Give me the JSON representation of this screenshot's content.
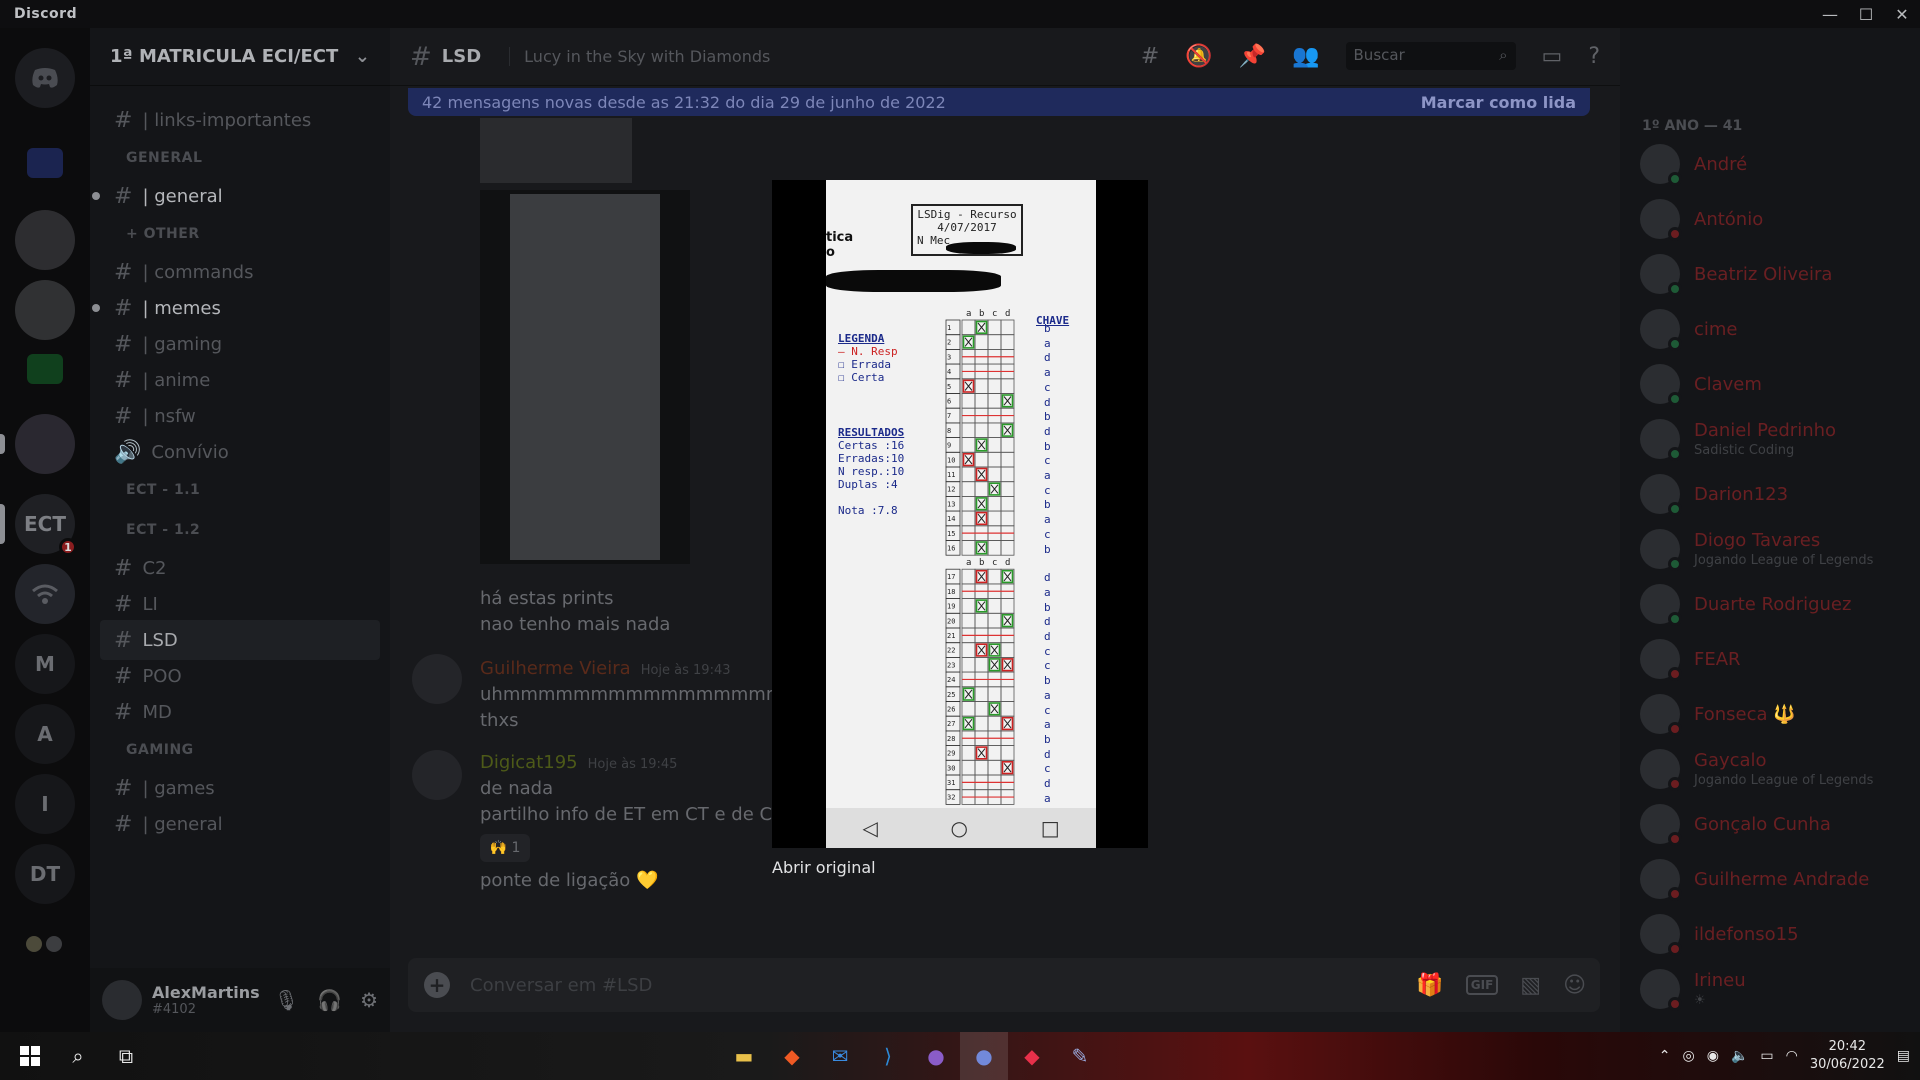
{
  "app": {
    "brand": "Discord"
  },
  "window_controls": {
    "minimize": "—",
    "maximize": "☐",
    "close": "✕"
  },
  "guilds": [
    {
      "label": "",
      "icon": "discord-home-icon"
    },
    {
      "label": "",
      "icon": "folder-icon"
    },
    {
      "label": "",
      "icon": "server-avatar"
    },
    {
      "label": "",
      "icon": "server-avatar"
    },
    {
      "label": "",
      "icon": "folder-icon"
    },
    {
      "label": "",
      "icon": "server-avatar"
    },
    {
      "label": "ECT",
      "badge": "1"
    },
    {
      "label": "",
      "icon": "wifi-server-icon"
    },
    {
      "label": "M"
    },
    {
      "label": "A"
    },
    {
      "label": "I"
    },
    {
      "label": "DT"
    }
  ],
  "server": {
    "name": "1ª MATRICULA ECI/ECT",
    "channels": [
      {
        "label": "| links-importantes",
        "type": "text",
        "state": "muted"
      },
      {
        "category": "GENERAL"
      },
      {
        "label": "| general",
        "type": "text",
        "state": "unread"
      },
      {
        "category": "+ OTHER"
      },
      {
        "label": "| commands",
        "type": "text",
        "state": "muted"
      },
      {
        "label": "| memes",
        "type": "text",
        "state": "unread"
      },
      {
        "label": "| gaming",
        "type": "text",
        "state": "muted"
      },
      {
        "label": "| anime",
        "type": "text",
        "state": "muted"
      },
      {
        "label": "| nsfw",
        "type": "text",
        "state": "muted"
      },
      {
        "label": "Convívio",
        "type": "voice",
        "state": "muted"
      },
      {
        "category": "ECT - 1.1"
      },
      {
        "category": "ECT - 1.2"
      },
      {
        "label": "C2",
        "type": "text",
        "state": "muted"
      },
      {
        "label": "LI",
        "type": "text",
        "state": "muted"
      },
      {
        "label": "LSD",
        "type": "text",
        "state": "active"
      },
      {
        "label": "POO",
        "type": "text",
        "state": "muted"
      },
      {
        "label": "MD",
        "type": "text",
        "state": "muted"
      },
      {
        "category": "GAMING"
      },
      {
        "label": "| games",
        "type": "text",
        "state": "muted"
      },
      {
        "label": "| general",
        "type": "text",
        "state": "muted"
      }
    ]
  },
  "user": {
    "name": "AlexMartins",
    "tag": "#4102"
  },
  "channel": {
    "name": "LSD",
    "topic": "Lucy in the Sky with Diamonds",
    "search_placeholder": "Buscar",
    "new_messages": "42 mensagens novas desde as 21:32 do dia 29 de junho de 2022",
    "mark_read": "Marcar como lida"
  },
  "messages": {
    "m1_line1": "há estas prints",
    "m1_line2": "nao tenho mais nada",
    "m2_author": "Guilherme Vieira",
    "m2_time": "Hoje às 19:43",
    "m2_line1": "uhmmmmmmmmmmmmmmmmmm",
    "m2_line2": "thxs",
    "m3_author": "Digicat195",
    "m3_time": "Hoje às 19:45",
    "m3_line1": "de nada",
    "m3_line2": "partilho info de ET em CT e de CT e",
    "m3_reaction_count": "1",
    "m3_line3": "ponte de ligação 💛",
    "composer_placeholder": "Conversar em #LSD"
  },
  "members": {
    "heading": "1º ANO — 41",
    "list": [
      {
        "name": "André",
        "status": "online"
      },
      {
        "name": "António",
        "status": "dnd"
      },
      {
        "name": "Beatriz Oliveira",
        "status": "online"
      },
      {
        "name": "cime",
        "status": "online"
      },
      {
        "name": "Clavem",
        "status": "online"
      },
      {
        "name": "Daniel Pedrinho",
        "activity": "Sadistic Coding",
        "status": "online"
      },
      {
        "name": "Darion123",
        "status": "online"
      },
      {
        "name": "Diogo Tavares",
        "activity": "Jogando League of Legends",
        "status": "online"
      },
      {
        "name": "Duarte Rodriguez",
        "status": "online"
      },
      {
        "name": "FEAR",
        "status": "dnd"
      },
      {
        "name": "Fonseca 🔱",
        "status": "dnd"
      },
      {
        "name": "Gaycalo",
        "activity": "Jogando League of Legends",
        "status": "dnd"
      },
      {
        "name": "Gonçalo Cunha",
        "status": "dnd"
      },
      {
        "name": "Guilherme Andrade",
        "status": "dnd"
      },
      {
        "name": "ildefonso15",
        "status": "dnd"
      },
      {
        "name": "Irineu",
        "activity": "☀",
        "status": "dnd"
      }
    ]
  },
  "viewer": {
    "open_original": "Abrir original",
    "stamp_line1": "LSDig - Recurso",
    "stamp_line2": "4/07/2017",
    "stamp_line3": "N Mec",
    "header_fragment_1": "tica",
    "header_fragment_2": "o",
    "legend_title": "LEGENDA",
    "legend_items": [
      "— N. Resp",
      "☐ Errada",
      "☐ Certa"
    ],
    "results_title": "RESULTADOS",
    "results": [
      "Certas :16",
      "Erradas:10",
      "N resp.:10",
      "Duplas :4"
    ],
    "grade": "Nota  :7.8",
    "key_title": "CHAVE",
    "grid_header": [
      "a",
      "b",
      "c",
      "d"
    ],
    "answer_key": [
      "b",
      "a",
      "d",
      "a",
      "c",
      "d",
      "b",
      "d",
      "b",
      "c",
      "a",
      "c",
      "b",
      "a",
      "c",
      "b",
      "d",
      "a",
      "b",
      "d",
      "d",
      "c",
      "c",
      "b",
      "a",
      "c",
      "a",
      "b",
      "d",
      "c",
      "d",
      "a"
    ],
    "marks": [
      {
        "q": 1,
        "col": 1,
        "result": "certa"
      },
      {
        "q": 2,
        "col": 0,
        "result": "certa"
      },
      {
        "q": 5,
        "col": 0,
        "result": "errada"
      },
      {
        "q": 6,
        "col": 3,
        "result": "certa"
      },
      {
        "q": 8,
        "col": 3,
        "result": "certa"
      },
      {
        "q": 9,
        "col": 1,
        "result": "certa"
      },
      {
        "q": 10,
        "col": 0,
        "result": "errada"
      },
      {
        "q": 11,
        "col": 1,
        "result": "errada"
      },
      {
        "q": 12,
        "col": 2,
        "result": "certa"
      },
      {
        "q": 13,
        "col": 1,
        "result": "certa"
      },
      {
        "q": 14,
        "col": 1,
        "result": "errada"
      },
      {
        "q": 16,
        "col": 1,
        "result": "certa"
      },
      {
        "q": 17,
        "col": 1,
        "result": "errada"
      },
      {
        "q": 17,
        "col": 3,
        "result": "certa"
      },
      {
        "q": 19,
        "col": 1,
        "result": "certa"
      },
      {
        "q": 20,
        "col": 3,
        "result": "certa"
      },
      {
        "q": 22,
        "col": 1,
        "result": "errada"
      },
      {
        "q": 22,
        "col": 2,
        "result": "certa"
      },
      {
        "q": 23,
        "col": 2,
        "result": "certa"
      },
      {
        "q": 23,
        "col": 3,
        "result": "errada"
      },
      {
        "q": 25,
        "col": 0,
        "result": "certa"
      },
      {
        "q": 26,
        "col": 2,
        "result": "certa"
      },
      {
        "q": 27,
        "col": 0,
        "result": "certa"
      },
      {
        "q": 27,
        "col": 3,
        "result": "errada"
      },
      {
        "q": 29,
        "col": 1,
        "result": "errada"
      },
      {
        "q": 30,
        "col": 3,
        "result": "errada"
      }
    ]
  },
  "taskbar": {
    "time": "20:42",
    "date": "30/06/2022",
    "apps": [
      "file-explorer-icon",
      "brave-icon",
      "mail-icon",
      "vscode-icon",
      "github-icon",
      "discord-icon",
      "jetbrains-icon",
      "paint-icon"
    ]
  }
}
